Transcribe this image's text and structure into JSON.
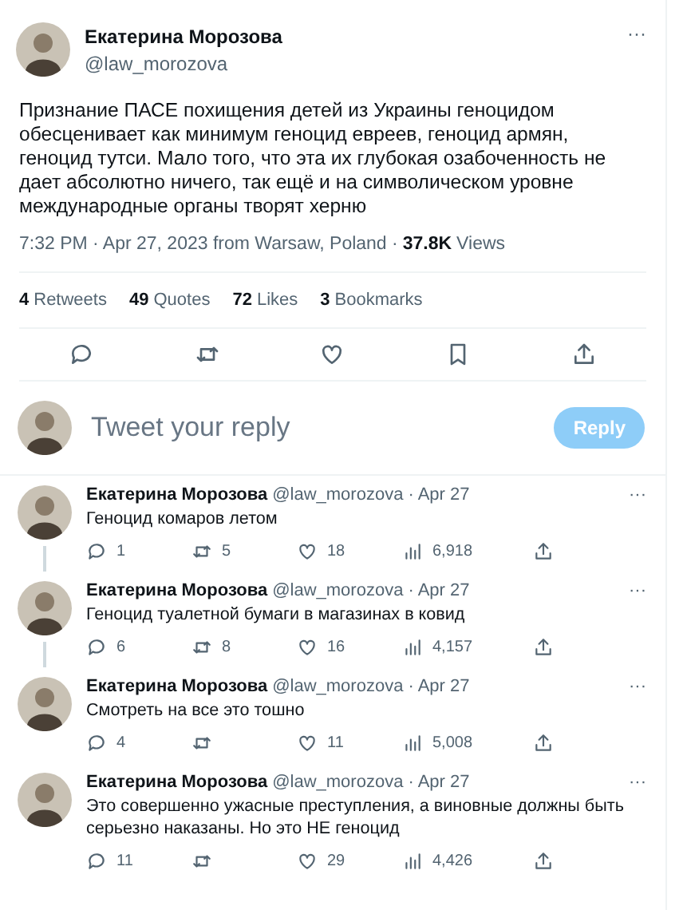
{
  "tweet": {
    "name": "Екатерина Морозова",
    "handle": "@law_morozova",
    "more": "···",
    "text": "Признание ПАСЕ похищения детей из Украины геноцидом обесценивает как минимум геноцид евреев, геноцид армян, геноцид тутси. Мало того, что эта их глубокая озабоченность не дает абсолютно ничего, так ещё и на символическом уровне международные органы творят херню",
    "meta": "7:32 PM · Apr 27, 2023 from Warsaw, Poland · ",
    "views_count": "37.8K",
    "views_label": "Views"
  },
  "stats": [
    {
      "count": "4",
      "label": "Retweets"
    },
    {
      "count": "49",
      "label": "Quotes"
    },
    {
      "count": "72",
      "label": "Likes"
    },
    {
      "count": "3",
      "label": "Bookmarks"
    }
  ],
  "actions": [
    {
      "kind": "reply"
    },
    {
      "kind": "retweet"
    },
    {
      "kind": "like"
    },
    {
      "kind": "bookmark"
    },
    {
      "kind": "share"
    }
  ],
  "composer": {
    "placeholder": "Tweet your reply",
    "button": "Reply",
    "disabled": true
  },
  "replies": [
    {
      "name": "Екатерина Морозова",
      "handle": "@law_morozova · Apr 27",
      "more": "···",
      "text": "Геноцид комаров летом",
      "thread": true,
      "counts": {
        "reply": "1",
        "retweet": "5",
        "like": "18",
        "views": "6,918"
      }
    },
    {
      "name": "Екатерина Морозова",
      "handle": "@law_morozova · Apr 27",
      "more": "···",
      "text": "Геноцид туалетной бумаги в магазинах в ковид",
      "thread": true,
      "counts": {
        "reply": "6",
        "retweet": "8",
        "like": "16",
        "views": "4,157"
      }
    },
    {
      "name": "Екатерина Морозова",
      "handle": "@law_morozova · Apr 27",
      "more": "···",
      "text": "Смотреть на все это тошно",
      "thread": false,
      "counts": {
        "reply": "4",
        "like": "11",
        "views": "5,008"
      }
    },
    {
      "name": "Екатерина Морозова",
      "handle": "@law_morozova · Apr 27",
      "more": "···",
      "text": "Это совершенно ужасные преступления, а виновные должны быть серьезно наказаны. Но это НЕ геноцид",
      "thread": false,
      "counts": {
        "reply": "11",
        "like": "29",
        "views": "4,426"
      }
    }
  ]
}
